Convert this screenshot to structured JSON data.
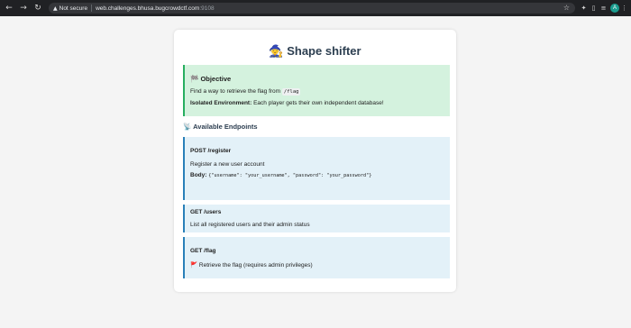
{
  "browser": {
    "back_icon": "arrow-left-icon",
    "forward_icon": "arrow-right-icon",
    "reload_icon": "reload-icon",
    "home_icon": "home-icon",
    "security_label": "Not secure",
    "url_host": "web.challenges.bhusa.bugcrowdctf.com",
    "url_port": ":9108",
    "profile_initial": "A"
  },
  "page": {
    "title_emoji": "🧙",
    "title": "Shape shifter",
    "objective": {
      "emoji": "🏁",
      "heading": "Objective",
      "line1_prefix": "Find a way to retrieve the flag from",
      "line1_code": "/flag",
      "line2_bold": "Isolated Environment:",
      "line2_rest": "Each player gets their own independent database!"
    },
    "endpoints_heading_emoji": "📡",
    "endpoints_heading": "Available Endpoints",
    "endpoints": [
      {
        "method": "POST /register",
        "description": "Register a new user account",
        "body_label": "Body:",
        "body_value": "{\"username\": \"your_username\", \"password\": \"your_password\"}"
      },
      {
        "method": "GET /users",
        "description": "List all registered users and their admin status"
      },
      {
        "method": "GET /flag",
        "description_emoji": "🚩",
        "description": "Retrieve the flag (requires admin privileges)"
      }
    ]
  },
  "colors": {
    "objective_bg": "#d4f2de",
    "objective_border": "#27ae60",
    "endpoint_bg": "#e3f1f8",
    "endpoint_border": "#2980b9",
    "title_color": "#2c3e50"
  }
}
